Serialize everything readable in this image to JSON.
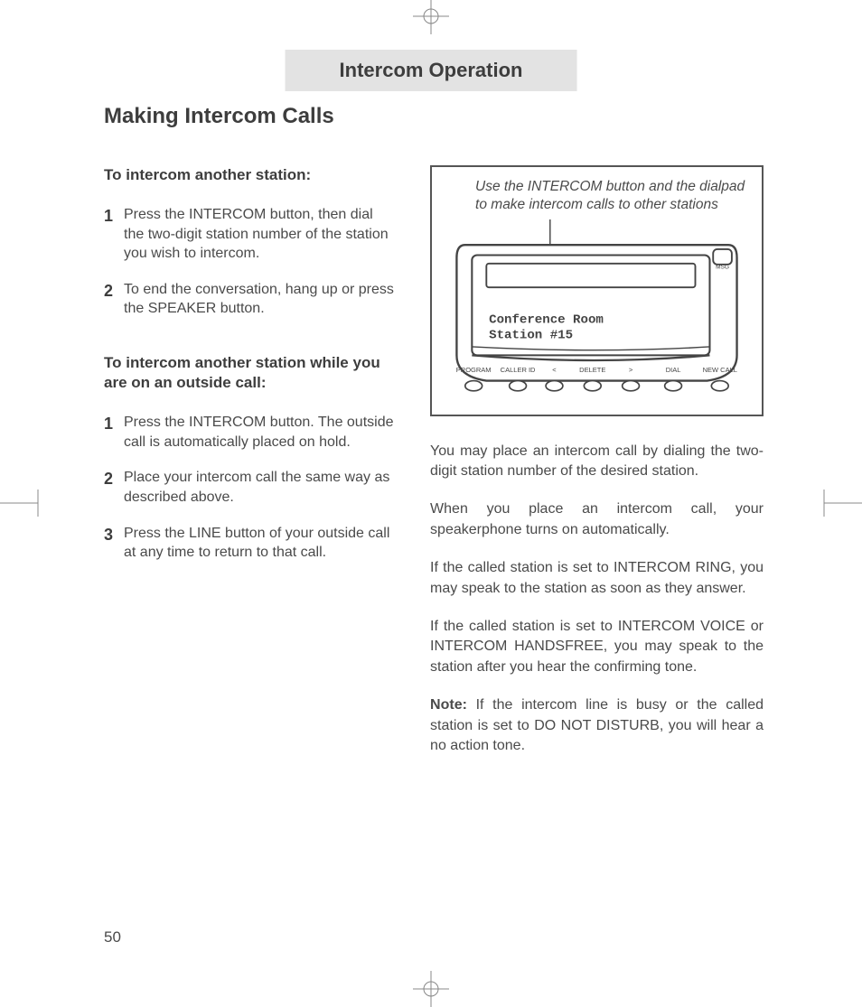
{
  "header": {
    "title": "Intercom Operation"
  },
  "section": {
    "title": "Making Intercom Calls"
  },
  "left": {
    "group1": {
      "heading": "To intercom another station:",
      "steps": [
        {
          "n": "1",
          "text": "Press the INTERCOM button, then dial the two-digit station number of the station you wish to intercom."
        },
        {
          "n": "2",
          "text": "To end the conversation, hang up or press the SPEAKER button."
        }
      ]
    },
    "group2": {
      "heading": "To intercom another station while you are on an outside call:",
      "steps": [
        {
          "n": "1",
          "text": "Press the INTERCOM button.  The outside call is automatically placed on hold."
        },
        {
          "n": "2",
          "text": "Place your intercom call the same way as described above."
        },
        {
          "n": "3",
          "text": "Press the LINE button of your outside call at any time to return to that call."
        }
      ]
    }
  },
  "illustration": {
    "caption": "Use the INTERCOM button and the dialpad to make intercom calls to other stations",
    "lcd_line1": "Conference Room",
    "lcd_line2": "Station #15",
    "btn_labels": {
      "program": "PROGRAM",
      "callerid": "CALLER ID",
      "lt": "<",
      "delete": "DELETE",
      "gt": ">",
      "dial": "DIAL",
      "newcall": "NEW CALL",
      "msg": "MSG"
    }
  },
  "right_paragraphs": [
    "You may place an intercom call by dialing the two-digit station number of the desired station.",
    "When you place an intercom call, your speakerphone turns on automatically.",
    "If the called station is set to INTERCOM RING, you may speak to the station as soon as they answer.",
    "If the called station is set to INTERCOM VOICE or INTERCOM HANDSFREE, you may speak to the station after you hear the confirming tone."
  ],
  "note": {
    "label": "Note:",
    "text": "  If the intercom line is busy or the called station is set to DO NOT DISTURB, you will hear a no action tone."
  },
  "page_number": "50"
}
